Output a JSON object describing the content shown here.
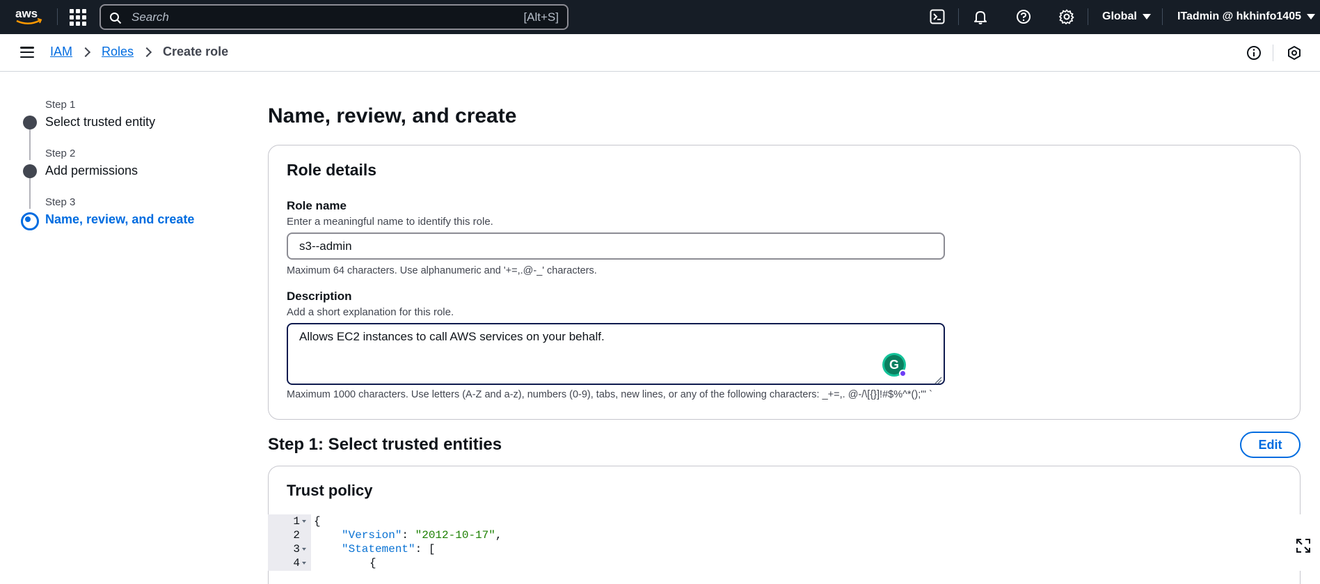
{
  "topnav": {
    "logo_text": "aws",
    "search_placeholder": "Search",
    "search_shortcut": "[Alt+S]",
    "region": "Global",
    "account": "ITadmin @ hkhinfo1405"
  },
  "breadcrumb": {
    "items": [
      "IAM",
      "Roles"
    ],
    "current": "Create role"
  },
  "steps": [
    {
      "label": "Step 1",
      "title": "Select trusted entity"
    },
    {
      "label": "Step 2",
      "title": "Add permissions"
    },
    {
      "label": "Step 3",
      "title": "Name, review, and create"
    }
  ],
  "page_title": "Name, review, and create",
  "role_details": {
    "title": "Role details",
    "role_name": {
      "label": "Role name",
      "description": "Enter a meaningful name to identify this role.",
      "value": "s3--admin",
      "hint": "Maximum 64 characters. Use alphanumeric and '+=,.@-_' characters."
    },
    "description": {
      "label": "Description",
      "description": "Add a short explanation for this role.",
      "value": "Allows EC2 instances to call AWS services on your behalf.",
      "hint": "Maximum 1000 characters. Use letters (A-Z and a-z), numbers (0-9), tabs, new lines, or any of the following characters: _+=,. @-/\\[{}]!#$%^*();\"' `"
    }
  },
  "step1_section": {
    "title": "Step 1: Select trusted entities",
    "edit_label": "Edit"
  },
  "trust_policy": {
    "title": "Trust policy",
    "lines": [
      {
        "n": "1",
        "fold": true
      },
      {
        "n": "2",
        "fold": false
      },
      {
        "n": "3",
        "fold": true
      },
      {
        "n": "4",
        "fold": true
      }
    ],
    "tokens": {
      "open_brace": "{",
      "version_key": "\"Version\"",
      "version_val": "\"2012-10-17\"",
      "statement_key": "\"Statement\"",
      "statement_open": ": [",
      "inner_brace": "{"
    }
  },
  "colors": {
    "nav_bg": "#161d26",
    "link": "#006ce0",
    "text": "#0f141a",
    "muted": "#424650"
  }
}
